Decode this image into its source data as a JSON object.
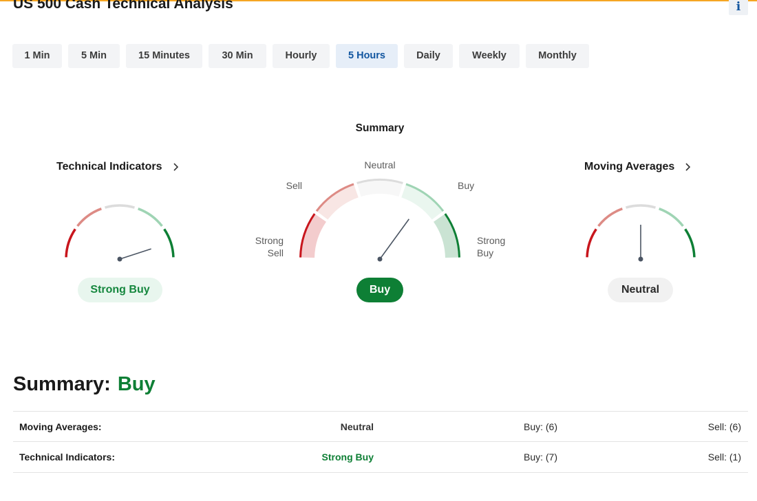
{
  "header": {
    "title": "US 500 Cash Technical Analysis",
    "info_label": "i"
  },
  "timeframes": [
    {
      "label": "1 Min"
    },
    {
      "label": "5 Min"
    },
    {
      "label": "15 Minutes"
    },
    {
      "label": "30 Min"
    },
    {
      "label": "Hourly"
    },
    {
      "label": "5 Hours",
      "active": true
    },
    {
      "label": "Daily"
    },
    {
      "label": "Weekly"
    },
    {
      "label": "Monthly"
    }
  ],
  "gauges": {
    "technical_indicators": {
      "title": "Technical Indicators",
      "status": "Strong Buy"
    },
    "summary": {
      "title": "Summary",
      "status": "Buy",
      "labels": {
        "strong_sell": "Strong\nSell",
        "sell": "Sell",
        "neutral": "Neutral",
        "buy": "Buy",
        "strong_buy": "Strong\nBuy"
      }
    },
    "moving_averages": {
      "title": "Moving Averages",
      "status": "Neutral"
    }
  },
  "summary_section": {
    "label": "Summary:",
    "value": "Buy",
    "rows": [
      {
        "label": "Moving Averages:",
        "status": "Neutral",
        "buy": "Buy: (6)",
        "sell": "Sell: (6)"
      },
      {
        "label": "Technical Indicators:",
        "status": "Strong Buy",
        "buy": "Buy: (7)",
        "sell": "Sell: (1)"
      }
    ]
  },
  "colors": {
    "accent_line": "#f5a623",
    "strong_sell": "#c8161d",
    "sell": "#dd8b85",
    "neutral": "#dcdcdc",
    "buy": "#9fd4b4",
    "strong_buy": "#0e7f35",
    "neutral_text": "#333333",
    "strong_buy_text": "#0e7f35"
  },
  "icons": {
    "chevron": "chevron-right-icon",
    "info": "info-icon"
  }
}
